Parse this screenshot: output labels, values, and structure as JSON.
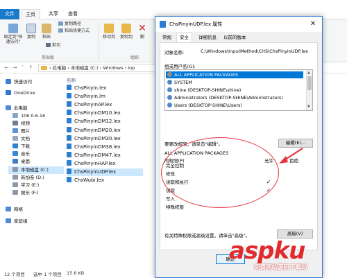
{
  "explorer": {
    "tabs": [
      "文件",
      "主页",
      "共享",
      "查看"
    ],
    "ribbon": {
      "pin_label": "固定到\"快\n速访问\"",
      "copy_label": "复制",
      "paste_label": "粘贴",
      "copy_path": "复制路径",
      "paste_shortcut": "粘贴快捷方式",
      "cut": "剪切",
      "clipboard_group": "剪贴板",
      "move_to": "移动到",
      "copy_to": "复制到",
      "delete": "删",
      "organize_group": "组织"
    },
    "address": {
      "crumbs": "›  此电脑  ›  本地磁盘 (C:)  ›  Windows  ›  Inp"
    },
    "nav": [
      {
        "label": "快速访问",
        "color": "#3a7fd5",
        "sub": false
      },
      {
        "label": "OneDrive",
        "color": "#2c78d2",
        "sub": false
      },
      {
        "label": "此电脑",
        "color": "#4b8bd9",
        "sub": false
      },
      {
        "label": "106.0.6.16",
        "color": "#8aa5c8",
        "sub": true
      },
      {
        "label": "视频",
        "color": "#6f7e95",
        "sub": true
      },
      {
        "label": "图片",
        "color": "#5e8fd0",
        "sub": true
      },
      {
        "label": "文档",
        "color": "#9aa8ba",
        "sub": true
      },
      {
        "label": "下载",
        "color": "#2f7fd7",
        "sub": true
      },
      {
        "label": "音乐",
        "color": "#3a86d8",
        "sub": true
      },
      {
        "label": "桌面",
        "color": "#3f7ec9",
        "sub": true
      },
      {
        "label": "本地磁盘 (C:)",
        "color": "#8e9aa8",
        "sub": true
      },
      {
        "label": "新加卷 (D:)",
        "color": "#8e9aa8",
        "sub": true
      },
      {
        "label": "学习 (E:)",
        "color": "#8e9aa8",
        "sub": true
      },
      {
        "label": "娱乐 (F:)",
        "color": "#8e9aa8",
        "sub": true
      },
      {
        "label": "网络",
        "color": "#4b8bd9",
        "sub": false
      },
      {
        "label": "家庭组",
        "color": "#4b8bd9",
        "sub": false
      }
    ],
    "files_header": "名称",
    "files": [
      "ChsPinyin.lex",
      "ChsPinyin.lm",
      "ChsPinyinAP.lex",
      "ChsPinyinDM10.lex",
      "ChsPinyinDM12.lex",
      "ChsPinyinDM20.lex",
      "ChsPinyinDM30.lex",
      "ChsPinyinDM38.lex",
      "ChsPinyinDM47.lex",
      "ChsPinyinHAP.lex",
      "ChsPinyinUDP.lex",
      "ChsWubi.lex"
    ],
    "selected_file_index": 10,
    "status": {
      "count": "12 个项目",
      "selected": "选中 1 个项目",
      "size": "15.6 KB"
    }
  },
  "dialog": {
    "title": "ChsPinyinUDP.lex 属性",
    "close": "✕",
    "tabs": [
      "常规",
      "安全",
      "详细信息",
      "以前的版本"
    ],
    "active_tab": 1,
    "object_name_label": "对象名称:",
    "object_name_value": "C:\\Windows\\InputMethod\\CHS\\ChsPinyinUDP.lex",
    "group_label": "组或用户名(G):",
    "groups": [
      {
        "name": "ALL APPLICATION PACKAGES",
        "color": "#8f8f8f"
      },
      {
        "name": "SYSTEM",
        "color": "#4f88c6"
      },
      {
        "name": "shine (DESKTOP-SHINE\\shine)",
        "color": "#4f88c6"
      },
      {
        "name": "Administrators (DESKTOP-SHINE\\Administrators)",
        "color": "#4f88c6"
      },
      {
        "name": "Users (DESKTOP-SHINE\\Users)",
        "color": "#4f88c6"
      }
    ],
    "change_perm_text": "要更改权限，请单击\"编辑\"。",
    "edit_button": "编辑(E)...",
    "perm_for": "ALL APPLICATION PACKAGES",
    "perm_label": "的权限(P)",
    "allow_header": "允许",
    "deny_header": "拒绝",
    "permissions": [
      {
        "name": "完全控制",
        "allow": "",
        "deny": ""
      },
      {
        "name": "修改",
        "allow": "",
        "deny": ""
      },
      {
        "name": "读取和执行",
        "allow": "✓",
        "deny": ""
      },
      {
        "name": "读取",
        "allow": "✓",
        "deny": ""
      },
      {
        "name": "写入",
        "allow": "",
        "deny": ""
      },
      {
        "name": "特殊权限",
        "allow": "",
        "deny": ""
      }
    ],
    "advanced_text": "有关特殊权限或高级设置，请单击\"高级\"。",
    "advanced_button": "高级(V)",
    "ok_button": "确定"
  },
  "watermark": {
    "logo": "aspku",
    "sub": "免费网站源码下载站"
  }
}
